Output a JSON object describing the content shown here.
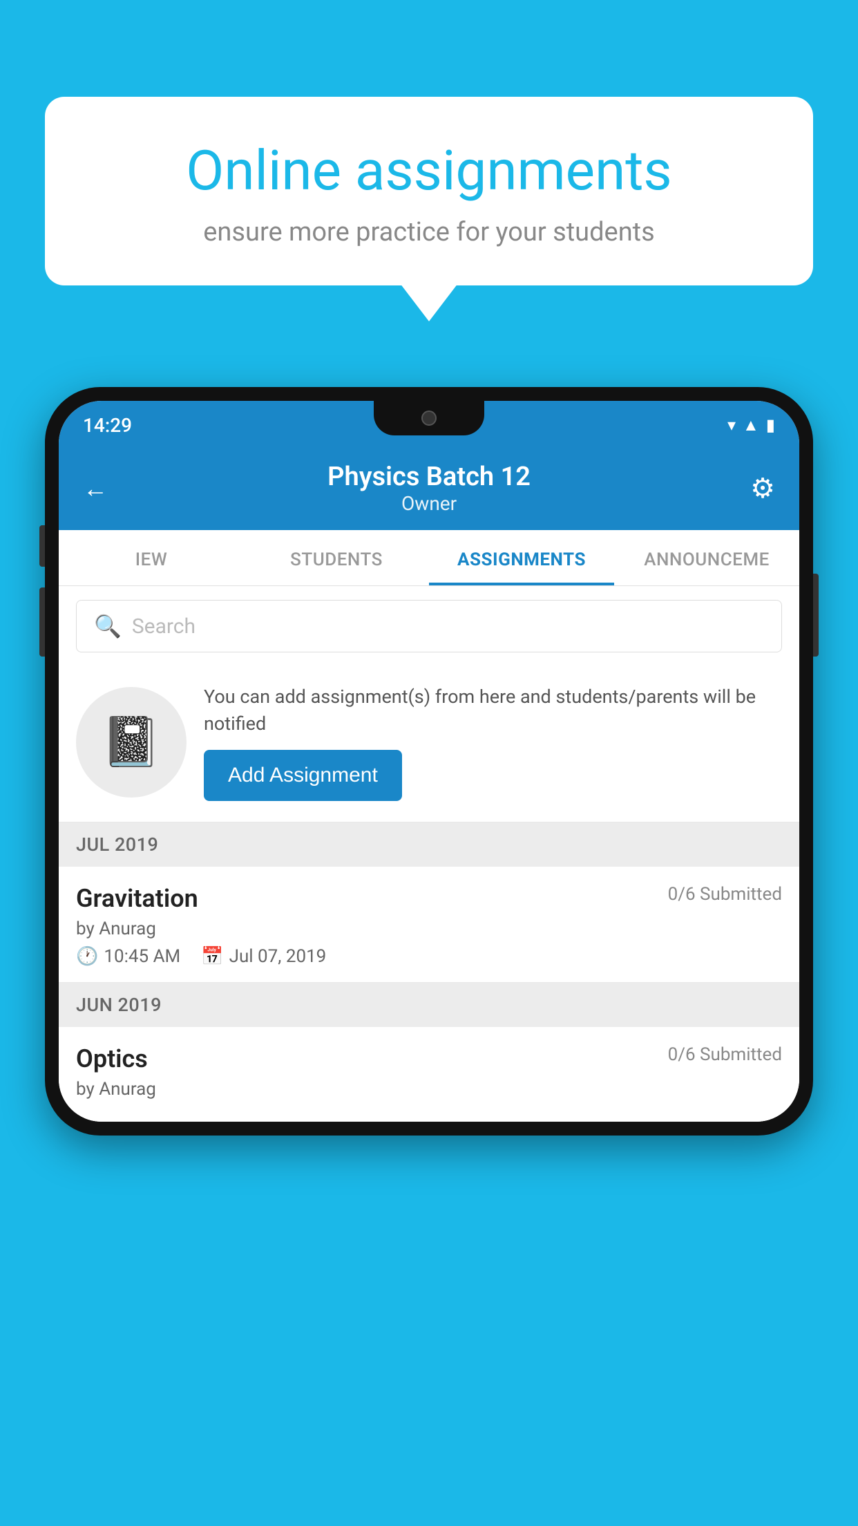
{
  "background": {
    "color": "#1bb8e8"
  },
  "speech_bubble": {
    "title": "Online assignments",
    "subtitle": "ensure more practice for your students"
  },
  "phone": {
    "status_bar": {
      "time": "14:29",
      "icons": [
        "wifi",
        "signal",
        "battery"
      ]
    },
    "header": {
      "title": "Physics Batch 12",
      "subtitle": "Owner",
      "back_label": "←",
      "settings_label": "⚙"
    },
    "tabs": [
      {
        "label": "IEW",
        "active": false
      },
      {
        "label": "STUDENTS",
        "active": false
      },
      {
        "label": "ASSIGNMENTS",
        "active": true
      },
      {
        "label": "ANNOUNCEME",
        "active": false
      }
    ],
    "search": {
      "placeholder": "Search"
    },
    "promo": {
      "text": "You can add assignment(s) from here and students/parents will be notified",
      "button_label": "Add Assignment"
    },
    "sections": [
      {
        "month": "JUL 2019",
        "assignments": [
          {
            "name": "Gravitation",
            "status": "0/6 Submitted",
            "by": "by Anurag",
            "time": "10:45 AM",
            "date": "Jul 07, 2019"
          }
        ]
      },
      {
        "month": "JUN 2019",
        "assignments": [
          {
            "name": "Optics",
            "status": "0/6 Submitted",
            "by": "by Anurag",
            "time": "",
            "date": ""
          }
        ]
      }
    ]
  }
}
